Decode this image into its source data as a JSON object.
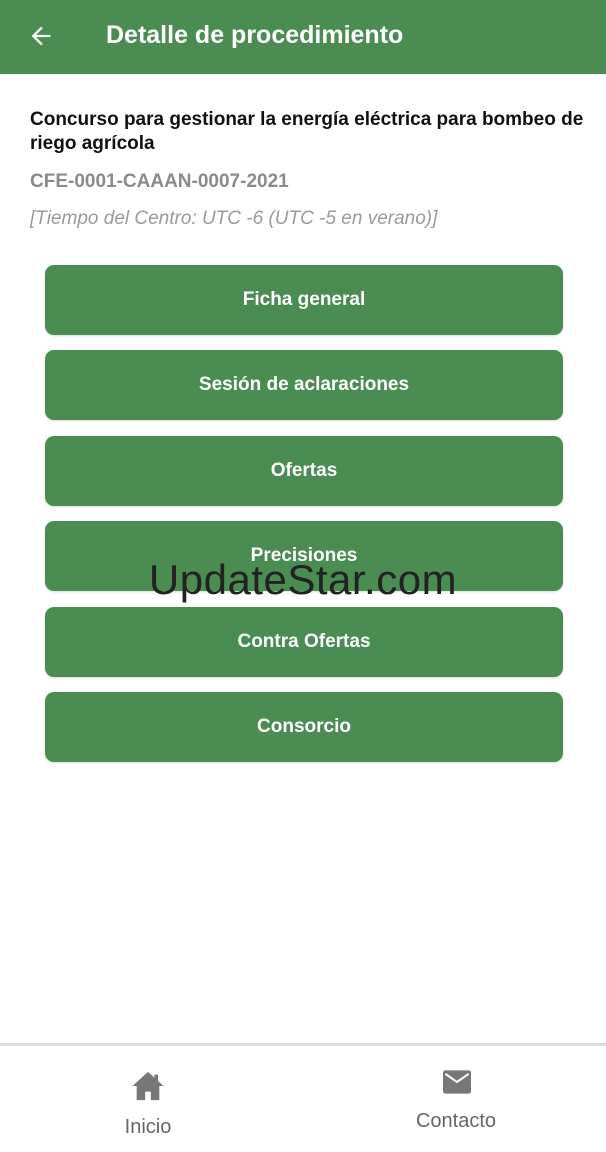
{
  "header": {
    "back_icon": "arrow-left-icon",
    "title": "Detalle de procedimiento",
    "color": "#4a8c52"
  },
  "procedure": {
    "title": "Concurso para gestionar la energía eléctrica para bombeo de riego agrícola",
    "code": "CFE-0001-CAAAN-0007-2021",
    "timezone_note": "[Tiempo del Centro: UTC -6 (UTC -5 en verano)]"
  },
  "menu": {
    "items": [
      {
        "label": "Ficha general"
      },
      {
        "label": "Sesión de aclaraciones"
      },
      {
        "label": "Ofertas"
      },
      {
        "label": "Precisiones"
      },
      {
        "label": "Contra Ofertas"
      },
      {
        "label": "Consorcio"
      }
    ]
  },
  "watermark": "UpdateStar.com",
  "bottom_nav": {
    "items": [
      {
        "label": "Inicio",
        "icon": "home-icon"
      },
      {
        "label": "Contacto",
        "icon": "mail-icon"
      }
    ]
  }
}
